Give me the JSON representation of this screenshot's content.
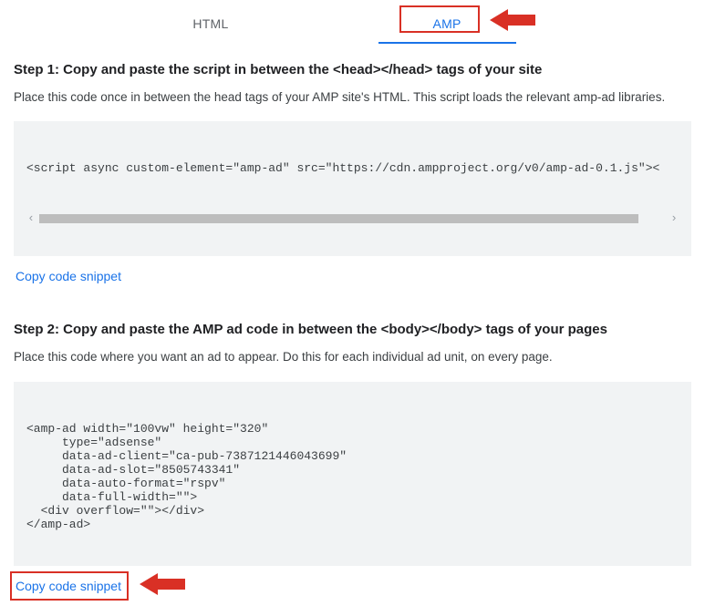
{
  "tabs": {
    "html": "HTML",
    "amp": "AMP"
  },
  "step1": {
    "title": "Step 1: Copy and paste the script in between the <head></head> tags of your site",
    "desc": "Place this code once in between the head tags of your AMP site's HTML. This script loads the relevant amp-ad libraries.",
    "code": "<script async custom-element=\"amp-ad\" src=\"https://cdn.ampproject.org/v0/amp-ad-0.1.js\"><",
    "copy": "Copy code snippet"
  },
  "step2": {
    "title": "Step 2: Copy and paste the AMP ad code in between the <body></body> tags of your pages",
    "desc": "Place this code where you want an ad to appear. Do this for each individual ad unit, on every page.",
    "code": "<amp-ad width=\"100vw\" height=\"320\"\n     type=\"adsense\"\n     data-ad-client=\"ca-pub-7387121446043699\"\n     data-ad-slot=\"8505743341\"\n     data-auto-format=\"rspv\"\n     data-full-width=\"\">\n  <div overflow=\"\"></div>\n</amp-ad>",
    "copy": "Copy code snippet"
  },
  "annotations": {
    "arrow_color": "#d93025",
    "highlight_color": "#d93025"
  }
}
